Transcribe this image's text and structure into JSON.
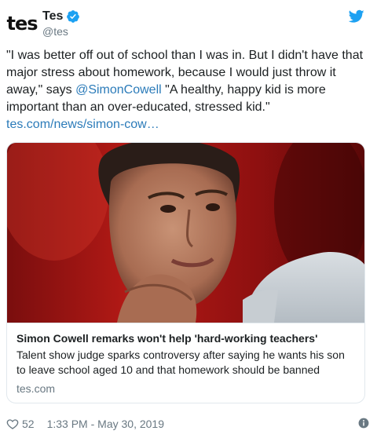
{
  "account": {
    "avatar_text": "tes",
    "display_name": "Tes",
    "handle": "@tes"
  },
  "tweet": {
    "text_before": "\"I was better off out of school than I was in. But I didn't have that major stress about homework, because I would just throw it away,\" says ",
    "mention": "@SimonCowell",
    "text_after": " \"A healthy, happy kid is more important than an over-educated, stressed kid.\"",
    "link": "tes.com/news/simon-cow…"
  },
  "card": {
    "title": "Simon Cowell remarks won't help 'hard-working teachers'",
    "description": "Talent show judge sparks controversy after saying he wants his son to leave school aged 10 and that homework should be banned",
    "domain": "tes.com"
  },
  "footer": {
    "likes": "52",
    "timestamp": "1:33 PM - May 30, 2019"
  },
  "icons": {
    "verified": "verified-badge-icon",
    "bird": "twitter-bird-icon",
    "heart": "heart-icon",
    "info": "info-icon"
  },
  "colors": {
    "link": "#2b7bb9",
    "verified": "#1da1f2",
    "muted": "#697882",
    "border": "#e1e8ed"
  }
}
